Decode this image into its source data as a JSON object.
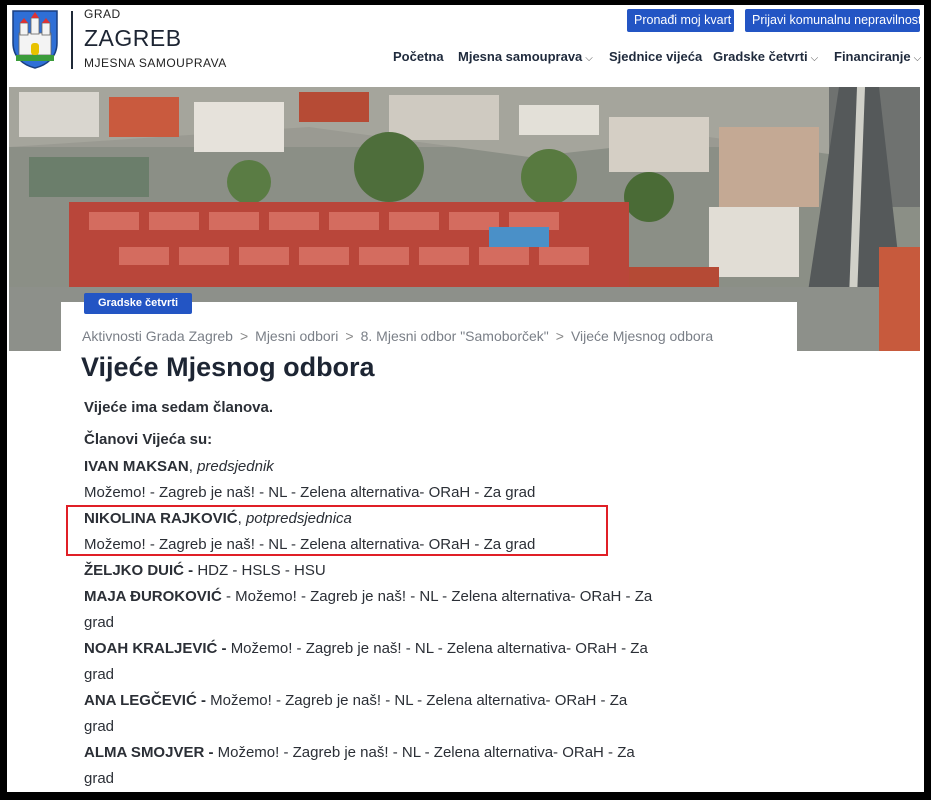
{
  "header": {
    "brand_small": "GRAD",
    "brand_big": "ZAGREB",
    "brand_sub": "MJESNA SAMOUPRAVA",
    "buttons": {
      "kvart": "Pronađi moj kvart",
      "prijavi": "Prijavi komunalnu nepravilnost"
    },
    "nav": [
      {
        "label": "Početna"
      },
      {
        "label": "Mjesna samouprava",
        "dropdown": "⌵"
      },
      {
        "label": "Sjednice vijeća"
      },
      {
        "label": "Gradske četvrti",
        "dropdown": "⌵"
      },
      {
        "label": "Financiranje",
        "dropdown": "⌵"
      }
    ]
  },
  "hero": {
    "tag": "Gradske četvrti"
  },
  "breadcrumb": {
    "items": [
      "Aktivnosti Grada Zagreb",
      "Mjesni odbori",
      "8. Mjesni odbor \"Samoborček\"",
      "Vijeće Mjesnog odbora"
    ],
    "separator": ">"
  },
  "page": {
    "title": "Vijeće Mjesnog odbora",
    "intro": "Vijeće ima sedam članova.",
    "members_heading": "Članovi Vijeća su:",
    "members": [
      {
        "name": "IVAN MAKSAN",
        "role": "predsjednik",
        "party": "Možemo! - Zagreb je naš! - NL - Zelena alternativa- ORaH - Za grad"
      },
      {
        "name": "NIKOLINA RAJKOVIĆ",
        "role": "potpredsjednica",
        "party": "Možemo! - Zagreb je naš! - NL - Zelena alternativa- ORaH - Za grad"
      },
      {
        "name": "ŽELJKO DUIĆ -",
        "party": "HDZ - HSLS - HSU"
      },
      {
        "name": "MAJA ĐUROKOVIĆ",
        "party_a": "- Možemo! - Zagreb je naš! - NL - Zelena alternativa- ORaH - Za",
        "party_b": "grad"
      },
      {
        "name": "NOAH KRALJEVIĆ -",
        "party_a": "Možemo! - Zagreb je naš! - NL - Zelena alternativa- ORaH - Za",
        "party_b": "grad"
      },
      {
        "name": "ANA LEGČEVIĆ -",
        "party_a": "Možemo! - Zagreb je naš! - NL - Zelena alternativa- ORaH - Za",
        "party_b": "grad"
      },
      {
        "name": "ALMA SMOJVER -",
        "party_a": "Možemo! - Zagreb je naš! - NL - Zelena alternativa- ORaH - Za",
        "party_b": "grad"
      }
    ]
  },
  "colors": {
    "accent": "#2355c4",
    "highlight": "#e01f26",
    "title": "#1d2533"
  }
}
